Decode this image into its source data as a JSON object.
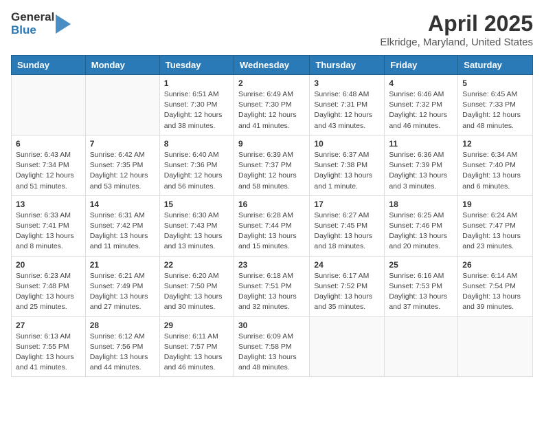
{
  "header": {
    "logo_general": "General",
    "logo_blue": "Blue",
    "month": "April 2025",
    "location": "Elkridge, Maryland, United States"
  },
  "weekdays": [
    "Sunday",
    "Monday",
    "Tuesday",
    "Wednesday",
    "Thursday",
    "Friday",
    "Saturday"
  ],
  "weeks": [
    [
      {
        "day": "",
        "info": ""
      },
      {
        "day": "",
        "info": ""
      },
      {
        "day": "1",
        "info": "Sunrise: 6:51 AM\nSunset: 7:30 PM\nDaylight: 12 hours and 38 minutes."
      },
      {
        "day": "2",
        "info": "Sunrise: 6:49 AM\nSunset: 7:30 PM\nDaylight: 12 hours and 41 minutes."
      },
      {
        "day": "3",
        "info": "Sunrise: 6:48 AM\nSunset: 7:31 PM\nDaylight: 12 hours and 43 minutes."
      },
      {
        "day": "4",
        "info": "Sunrise: 6:46 AM\nSunset: 7:32 PM\nDaylight: 12 hours and 46 minutes."
      },
      {
        "day": "5",
        "info": "Sunrise: 6:45 AM\nSunset: 7:33 PM\nDaylight: 12 hours and 48 minutes."
      }
    ],
    [
      {
        "day": "6",
        "info": "Sunrise: 6:43 AM\nSunset: 7:34 PM\nDaylight: 12 hours and 51 minutes."
      },
      {
        "day": "7",
        "info": "Sunrise: 6:42 AM\nSunset: 7:35 PM\nDaylight: 12 hours and 53 minutes."
      },
      {
        "day": "8",
        "info": "Sunrise: 6:40 AM\nSunset: 7:36 PM\nDaylight: 12 hours and 56 minutes."
      },
      {
        "day": "9",
        "info": "Sunrise: 6:39 AM\nSunset: 7:37 PM\nDaylight: 12 hours and 58 minutes."
      },
      {
        "day": "10",
        "info": "Sunrise: 6:37 AM\nSunset: 7:38 PM\nDaylight: 13 hours and 1 minute."
      },
      {
        "day": "11",
        "info": "Sunrise: 6:36 AM\nSunset: 7:39 PM\nDaylight: 13 hours and 3 minutes."
      },
      {
        "day": "12",
        "info": "Sunrise: 6:34 AM\nSunset: 7:40 PM\nDaylight: 13 hours and 6 minutes."
      }
    ],
    [
      {
        "day": "13",
        "info": "Sunrise: 6:33 AM\nSunset: 7:41 PM\nDaylight: 13 hours and 8 minutes."
      },
      {
        "day": "14",
        "info": "Sunrise: 6:31 AM\nSunset: 7:42 PM\nDaylight: 13 hours and 11 minutes."
      },
      {
        "day": "15",
        "info": "Sunrise: 6:30 AM\nSunset: 7:43 PM\nDaylight: 13 hours and 13 minutes."
      },
      {
        "day": "16",
        "info": "Sunrise: 6:28 AM\nSunset: 7:44 PM\nDaylight: 13 hours and 15 minutes."
      },
      {
        "day": "17",
        "info": "Sunrise: 6:27 AM\nSunset: 7:45 PM\nDaylight: 13 hours and 18 minutes."
      },
      {
        "day": "18",
        "info": "Sunrise: 6:25 AM\nSunset: 7:46 PM\nDaylight: 13 hours and 20 minutes."
      },
      {
        "day": "19",
        "info": "Sunrise: 6:24 AM\nSunset: 7:47 PM\nDaylight: 13 hours and 23 minutes."
      }
    ],
    [
      {
        "day": "20",
        "info": "Sunrise: 6:23 AM\nSunset: 7:48 PM\nDaylight: 13 hours and 25 minutes."
      },
      {
        "day": "21",
        "info": "Sunrise: 6:21 AM\nSunset: 7:49 PM\nDaylight: 13 hours and 27 minutes."
      },
      {
        "day": "22",
        "info": "Sunrise: 6:20 AM\nSunset: 7:50 PM\nDaylight: 13 hours and 30 minutes."
      },
      {
        "day": "23",
        "info": "Sunrise: 6:18 AM\nSunset: 7:51 PM\nDaylight: 13 hours and 32 minutes."
      },
      {
        "day": "24",
        "info": "Sunrise: 6:17 AM\nSunset: 7:52 PM\nDaylight: 13 hours and 35 minutes."
      },
      {
        "day": "25",
        "info": "Sunrise: 6:16 AM\nSunset: 7:53 PM\nDaylight: 13 hours and 37 minutes."
      },
      {
        "day": "26",
        "info": "Sunrise: 6:14 AM\nSunset: 7:54 PM\nDaylight: 13 hours and 39 minutes."
      }
    ],
    [
      {
        "day": "27",
        "info": "Sunrise: 6:13 AM\nSunset: 7:55 PM\nDaylight: 13 hours and 41 minutes."
      },
      {
        "day": "28",
        "info": "Sunrise: 6:12 AM\nSunset: 7:56 PM\nDaylight: 13 hours and 44 minutes."
      },
      {
        "day": "29",
        "info": "Sunrise: 6:11 AM\nSunset: 7:57 PM\nDaylight: 13 hours and 46 minutes."
      },
      {
        "day": "30",
        "info": "Sunrise: 6:09 AM\nSunset: 7:58 PM\nDaylight: 13 hours and 48 minutes."
      },
      {
        "day": "",
        "info": ""
      },
      {
        "day": "",
        "info": ""
      },
      {
        "day": "",
        "info": ""
      }
    ]
  ]
}
